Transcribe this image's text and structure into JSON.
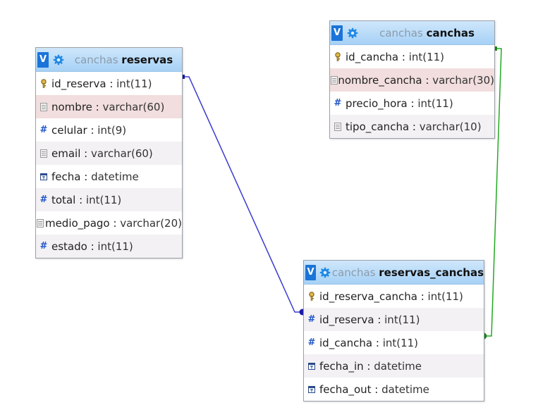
{
  "tables": {
    "reservas": {
      "db": "canchas",
      "name": "reservas",
      "fields": [
        {
          "name": "id_reserva",
          "type": "int(11)",
          "icon": "primary-key-icon"
        },
        {
          "name": "nombre",
          "type": "varchar(60)",
          "icon": "text-field-icon"
        },
        {
          "name": "celular",
          "type": "int(9)",
          "icon": "number-field-icon"
        },
        {
          "name": "email",
          "type": "varchar(60)",
          "icon": "text-field-icon"
        },
        {
          "name": "fecha",
          "type": "datetime",
          "icon": "date-field-icon"
        },
        {
          "name": "total",
          "type": "int(11)",
          "icon": "number-field-icon"
        },
        {
          "name": "medio_pago",
          "type": "varchar(20)",
          "icon": "text-field-icon"
        },
        {
          "name": "estado",
          "type": "int(11)",
          "icon": "number-field-icon"
        }
      ]
    },
    "canchas": {
      "db": "canchas",
      "name": "canchas",
      "fields": [
        {
          "name": "id_cancha",
          "type": "int(11)",
          "icon": "primary-key-icon"
        },
        {
          "name": "nombre_cancha",
          "type": "varchar(30)",
          "icon": "text-field-icon"
        },
        {
          "name": "precio_hora",
          "type": "int(11)",
          "icon": "number-field-icon"
        },
        {
          "name": "tipo_cancha",
          "type": "varchar(10)",
          "icon": "text-field-icon"
        }
      ]
    },
    "reservas_canchas": {
      "db": "canchas",
      "name": "reservas_canchas",
      "fields": [
        {
          "name": "id_reserva_cancha",
          "type": "int(11)",
          "icon": "primary-key-icon"
        },
        {
          "name": "id_reserva",
          "type": "int(11)",
          "icon": "number-field-icon"
        },
        {
          "name": "id_cancha",
          "type": "int(11)",
          "icon": "number-field-icon"
        },
        {
          "name": "fecha_in",
          "type": "datetime",
          "icon": "date-field-icon"
        },
        {
          "name": "fecha_out",
          "type": "datetime",
          "icon": "date-field-icon"
        }
      ]
    }
  },
  "toggle_label": "V",
  "separator": " : ",
  "relations": [
    {
      "from": "reservas.id_reserva",
      "to": "reservas_canchas.id_reserva",
      "color": "#3b3bd0"
    },
    {
      "from": "canchas.id_cancha",
      "to": "reservas_canchas.id_cancha",
      "color": "#22aa22"
    }
  ],
  "colors": {
    "header_bg": "#a6d1f6",
    "toggle_bg": "#1b74d8",
    "highlight_row": "#f2dede",
    "alt_row": "#f3f1f4"
  }
}
